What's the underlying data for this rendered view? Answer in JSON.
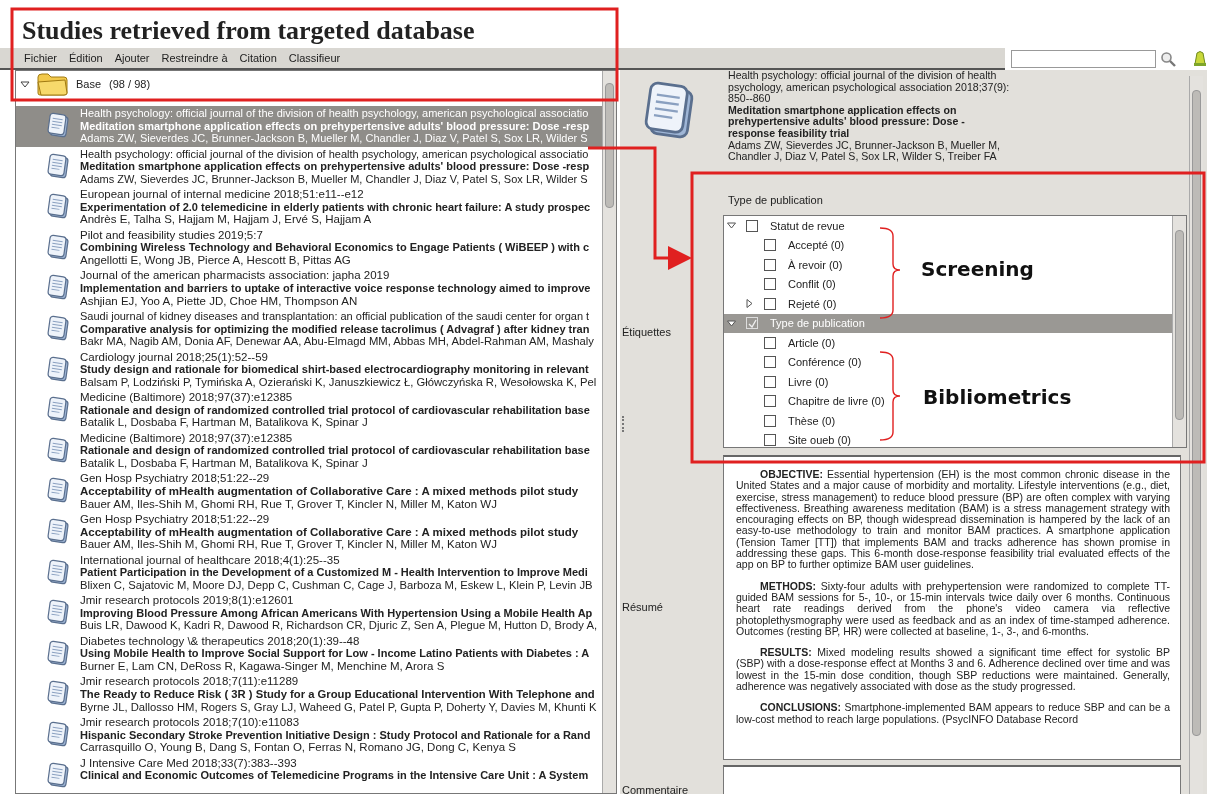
{
  "page_title": "Studies retrieved from targeted database",
  "menu": [
    "Fichier",
    "Édition",
    "Ajouter",
    "Restreindre à",
    "Citation",
    "Classifieur"
  ],
  "tree_root": {
    "label": "Base",
    "count": "(98 / 98)",
    "expanded": true
  },
  "records": [
    {
      "journal": "Health psychology: official journal of the division of health psychology, american psychological associatio",
      "title": "Meditation smartphone application effects on prehypertensive adults' blood pressure: Dose -resp",
      "authors": "Adams ZW, Sieverdes JC, Brunner-Jackson B, Mueller M, Chandler J, Diaz V, Patel S, Sox LR, Wilder S",
      "selected": true
    },
    {
      "journal": "Health psychology: official journal of the division of health psychology, american psychological associatio",
      "title": "Meditation smartphone application effects on prehypertensive adults' blood pressure: Dose -resp",
      "authors": "Adams ZW, Sieverdes JC, Brunner-Jackson B, Mueller M, Chandler J, Diaz V, Patel S, Sox LR, Wilder S",
      "selected": false
    },
    {
      "journal": "European journal of internal medicine 2018;51:e11--e12",
      "title": "Experimentation of 2.0 telemedicine in elderly patients with chronic heart failure: A study prospec",
      "authors": "Andrès E, Talha S, Hajjam M, Hajjam J, Ervé S, Hajjam A",
      "selected": false
    },
    {
      "journal": "Pilot and feasibility studies 2019;5:7",
      "title": "Combining Wireless Technology and Behavioral Economics to Engage Patients ( WiBEEP ) with c",
      "authors": "Angellotti E, Wong JB, Pierce A, Hescott B, Pittas AG",
      "selected": false
    },
    {
      "journal": "Journal of the american pharmacists association: japha 2019",
      "title": "Implementation and barriers to uptake of interactive voice response technology aimed to improve",
      "authors": "Ashjian EJ, Yoo A, Piette JD, Choe HM, Thompson AN",
      "selected": false
    },
    {
      "journal": "Saudi journal of kidney diseases and transplantation: an official publication of the saudi center for organ t",
      "title": "Comparative analysis for optimizing the modified release tacrolimus ( Advagraf ) after kidney tran",
      "authors": "Bakr MA, Nagib AM, Donia AF, Denewar AA, Abu-Elmagd MM, Abbas MH, Abdel-Rahman AM, Mashaly",
      "selected": false
    },
    {
      "journal": "Cardiology journal 2018;25(1):52--59",
      "title": "Study design and rationale for biomedical shirt-based electrocardiography monitoring in relevant",
      "authors": "Balsam P, Lodziński P, Tymińska A, Ozierański K, Januszkiewicz Ł, Główczyńska R, Wesołowska K, Pel",
      "selected": false
    },
    {
      "journal": "Medicine (Baltimore) 2018;97(37):e12385",
      "title": "Rationale and design of randomized controlled trial protocol of cardiovascular rehabilitation base",
      "authors": "Batalik L, Dosbaba F, Hartman M, Batalikova K, Spinar J",
      "selected": false
    },
    {
      "journal": "Medicine (Baltimore) 2018;97(37):e12385",
      "title": "Rationale and design of randomized controlled trial protocol of cardiovascular rehabilitation base",
      "authors": "Batalik L, Dosbaba F, Hartman M, Batalikova K, Spinar J",
      "selected": false
    },
    {
      "journal": "Gen Hosp Psychiatry 2018;51:22--29",
      "title": "Acceptability of mHealth augmentation of Collaborative Care : A mixed methods pilot study",
      "authors": "Bauer AM, Iles-Shih M, Ghomi RH, Rue T, Grover T, Kincler N, Miller M, Katon WJ",
      "selected": false
    },
    {
      "journal": "Gen Hosp Psychiatry 2018;51:22--29",
      "title": "Acceptability of mHealth augmentation of Collaborative Care : A mixed methods pilot study",
      "authors": "Bauer AM, Iles-Shih M, Ghomi RH, Rue T, Grover T, Kincler N, Miller M, Katon WJ",
      "selected": false
    },
    {
      "journal": "International journal of healthcare 2018;4(1):25--35",
      "title": "Patient Participation in the Development of a Customized M - Health Intervention to Improve Medi",
      "authors": "Blixen C, Sajatovic M, Moore DJ, Depp C, Cushman C, Cage J, Barboza M, Eskew L, Klein P, Levin JB",
      "selected": false
    },
    {
      "journal": "Jmir research protocols 2019;8(1):e12601",
      "title": "Improving Blood Pressure Among African Americans With Hypertension Using a Mobile Health Ap",
      "authors": "Buis LR, Dawood K, Kadri R, Dawood R, Richardson CR, Djuric Z, Sen A, Plegue M, Hutton D, Brody A,",
      "selected": false
    },
    {
      "journal": "Diabetes technology \\& therapeutics 2018;20(1):39--48",
      "title": "Using Mobile Health to Improve Social Support for Low - Income Latino Patients with Diabetes : A",
      "authors": "Burner E, Lam CN, DeRoss R, Kagawa-Singer M, Menchine M, Arora S",
      "selected": false
    },
    {
      "journal": "Jmir research protocols 2018;7(11):e11289",
      "title": "The Ready to Reduce Risk ( 3R ) Study for a Group Educational Intervention With Telephone and",
      "authors": "Byrne JL, Dallosso HM, Rogers S, Gray LJ, Waheed G, Patel P, Gupta P, Doherty Y, Davies M, Khunti K",
      "selected": false
    },
    {
      "journal": "Jmir research protocols 2018;7(10):e11083",
      "title": "Hispanic Secondary Stroke Prevention Initiative Design : Study Protocol and Rationale for a Rand",
      "authors": "Carrasquillo O, Young B, Dang S, Fontan O, Ferras N, Romano JG, Dong C, Kenya S",
      "selected": false
    },
    {
      "journal": "J Intensive Care Med 2018;33(7):383--393",
      "title": "Clinical and Economic Outcomes of Telemedicine Programs in the Intensive Care Unit : A System",
      "selected": false
    }
  ],
  "detail": {
    "journal": "Health psychology: official journal of the division of health psychology, american psychological association 2018;37(9): 850--860",
    "title": "Meditation smartphone application effects on prehypertensive adults' blood pressure: Dose -response feasibility trial",
    "authors": "Adams ZW, Sieverdes JC, Brunner-Jackson B, Mueller M, Chandler J, Diaz V, Patel S, Sox LR, Wilder S, Treiber FA"
  },
  "tags_caption": "Type de publication",
  "field_labels": {
    "tags": "Étiquettes",
    "abstract": "Résumé",
    "comment": "Commentaire"
  },
  "tags": [
    {
      "label": "Statut de revue",
      "kind": "group",
      "expanded": true,
      "checked": false,
      "selected": false,
      "children": [
        {
          "label": "Accepté (0)",
          "kind": "tag",
          "checked": false,
          "selected": false
        },
        {
          "label": "À revoir (0)",
          "kind": "tag",
          "checked": false,
          "selected": false
        },
        {
          "label": "Conflit (0)",
          "kind": "tag",
          "checked": false,
          "selected": false
        },
        {
          "label": "Rejeté (0)",
          "kind": "group",
          "expanded": false,
          "checked": false,
          "selected": false
        }
      ]
    },
    {
      "label": "Type de publication",
      "kind": "group",
      "expanded": true,
      "checked": true,
      "selected": true,
      "children": [
        {
          "label": "Article (0)",
          "kind": "tag",
          "checked": false,
          "selected": false
        },
        {
          "label": "Conférence (0)",
          "kind": "tag",
          "checked": false,
          "selected": false
        },
        {
          "label": "Livre (0)",
          "kind": "tag",
          "checked": false,
          "selected": false
        },
        {
          "label": "Chapitre de livre (0)",
          "kind": "tag",
          "checked": false,
          "selected": false
        },
        {
          "label": "Thèse (0)",
          "kind": "tag",
          "checked": false,
          "selected": false
        },
        {
          "label": "Site oueb (0)",
          "kind": "tag",
          "checked": false,
          "selected": false
        }
      ]
    }
  ],
  "abstract": [
    "**OBJECTIVE:** Essential hypertension (EH) is the most common chronic disease in the United States and a major cause of morbidity and mortality. Lifestyle interventions (e.g., diet, exercise, stress management) to reduce blood pressure (BP) are often complex with varying effectiveness. Breathing awareness meditation (BAM) is a stress management strategy with encouraging effects on BP, though widespread dissemination is hampered by the lack of an easy-to-use methodology to train and monitor BAM practices. A smartphone application (Tension Tamer [TT]) that implements BAM and tracks adherence has shown promise in addressing these gaps. This 6-month dose-response feasibility trial evaluated effects of the app on BP to further optimize BAM user guidelines.",
    "**METHODS:** Sixty-four adults with prehypertension were randomized to complete TT-guided BAM sessions for 5-, 10-, or 15-min intervals twice daily over 6 months. Continuous heart rate readings derived from the phone's video camera via reflective photoplethysmography were used as feedback and as an index of time-stamped adherence. Outcomes (resting BP, HR) were collected at baseline, 1-, 3-, and 6-months.",
    "**RESULTS:** Mixed modeling results showed a significant time effect for systolic BP (SBP) with a dose-response effect at Months 3 and 6. Adherence declined over time and was lowest in the 15-min dose condition, though SBP reductions were maintained. Generally, adherence was negatively associated with dose as the study progressed.",
    "**CONCLUSIONS:** Smartphone-implemented BAM appears to reduce SBP and can be a low-cost method to reach large populations. (PsycINFO Database Record"
  ],
  "annotations": {
    "screening_label": "Screening",
    "bibliometrics_label": "Bibliometrics"
  }
}
